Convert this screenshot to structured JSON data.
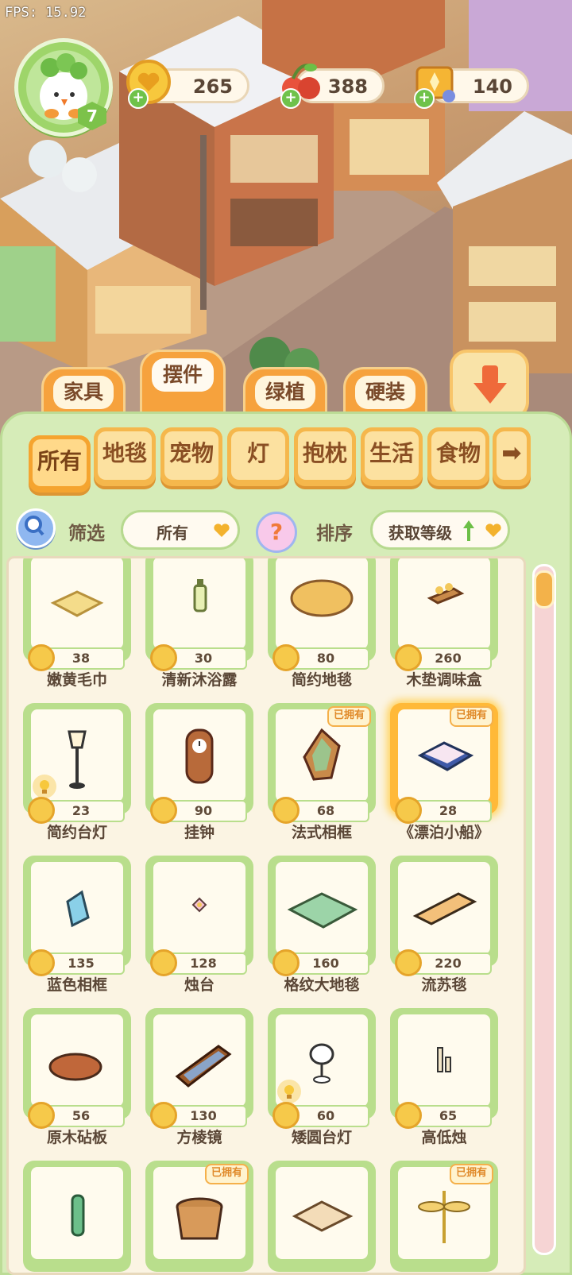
{
  "fps": "FPS: 15.92",
  "player": {
    "level": "7"
  },
  "currencies": [
    {
      "name": "coin",
      "value": "265",
      "icon": "coin-icon"
    },
    {
      "name": "fruit",
      "value": "388",
      "icon": "cherry-icon"
    },
    {
      "name": "ticket",
      "value": "140",
      "icon": "ticket-icon"
    }
  ],
  "category_tabs": [
    {
      "label": "家具",
      "active": false
    },
    {
      "label": "摆件",
      "active": true
    },
    {
      "label": "绿植",
      "active": false
    },
    {
      "label": "硬装",
      "active": false
    }
  ],
  "sub_tabs": [
    {
      "label": "所有",
      "active": true
    },
    {
      "label": "地毯",
      "active": false
    },
    {
      "label": "宠物",
      "active": false
    },
    {
      "label": "灯",
      "active": false
    },
    {
      "label": "抱枕",
      "active": false
    },
    {
      "label": "生活",
      "active": false
    },
    {
      "label": "食物",
      "active": false
    }
  ],
  "sub_tabs_more": "➡",
  "filter": {
    "label": "筛选",
    "value": "所有"
  },
  "help_glyph": "?",
  "sort": {
    "label": "排序",
    "value": "获取等级"
  },
  "owned_tag": "已拥有",
  "items": [
    {
      "name": "嫩黄毛巾",
      "price": "38",
      "owned": false,
      "lamp": false,
      "art": "towel"
    },
    {
      "name": "清新沐浴露",
      "price": "30",
      "owned": false,
      "lamp": false,
      "art": "bottle"
    },
    {
      "name": "简约地毯",
      "price": "80",
      "owned": false,
      "lamp": false,
      "art": "rug-oval"
    },
    {
      "name": "木垫调味盒",
      "price": "260",
      "owned": false,
      "lamp": false,
      "art": "spice"
    },
    {
      "name": "简约台灯",
      "price": "23",
      "owned": false,
      "lamp": true,
      "art": "floor-lamp"
    },
    {
      "name": "挂钟",
      "price": "90",
      "owned": false,
      "lamp": false,
      "art": "clock"
    },
    {
      "name": "法式相框",
      "price": "68",
      "owned": true,
      "lamp": false,
      "art": "frame-french"
    },
    {
      "name": "《漂泊小船》",
      "price": "28",
      "owned": true,
      "lamp": false,
      "art": "book",
      "selected": true
    },
    {
      "name": "蓝色相框",
      "price": "135",
      "owned": false,
      "lamp": false,
      "art": "frame-blue"
    },
    {
      "name": "烛台",
      "price": "128",
      "owned": false,
      "lamp": false,
      "art": "candle-flower"
    },
    {
      "name": "格纹大地毯",
      "price": "160",
      "owned": false,
      "lamp": false,
      "art": "rug-check"
    },
    {
      "name": "流苏毯",
      "price": "220",
      "owned": false,
      "lamp": false,
      "art": "rug-tassel"
    },
    {
      "name": "原木砧板",
      "price": "56",
      "owned": false,
      "lamp": false,
      "art": "board"
    },
    {
      "name": "方棱镜",
      "price": "130",
      "owned": false,
      "lamp": false,
      "art": "mirror"
    },
    {
      "name": "矮圆台灯",
      "price": "60",
      "owned": false,
      "lamp": true,
      "art": "table-lamp"
    },
    {
      "name": "高低烛",
      "price": "65",
      "owned": false,
      "lamp": false,
      "art": "candles"
    },
    {
      "name": "",
      "price": "",
      "owned": false,
      "lamp": false,
      "art": "vase-green"
    },
    {
      "name": "",
      "price": "",
      "owned": true,
      "lamp": false,
      "art": "basket"
    },
    {
      "name": "",
      "price": "",
      "owned": false,
      "lamp": false,
      "art": "mat"
    },
    {
      "name": "",
      "price": "",
      "owned": true,
      "lamp": false,
      "art": "dragonfly"
    }
  ],
  "colors": {
    "panel": "#d6ecb8",
    "card_border": "#b9de8c",
    "tab_orange": "#f6a23d",
    "text_brown": "#5a4636"
  }
}
